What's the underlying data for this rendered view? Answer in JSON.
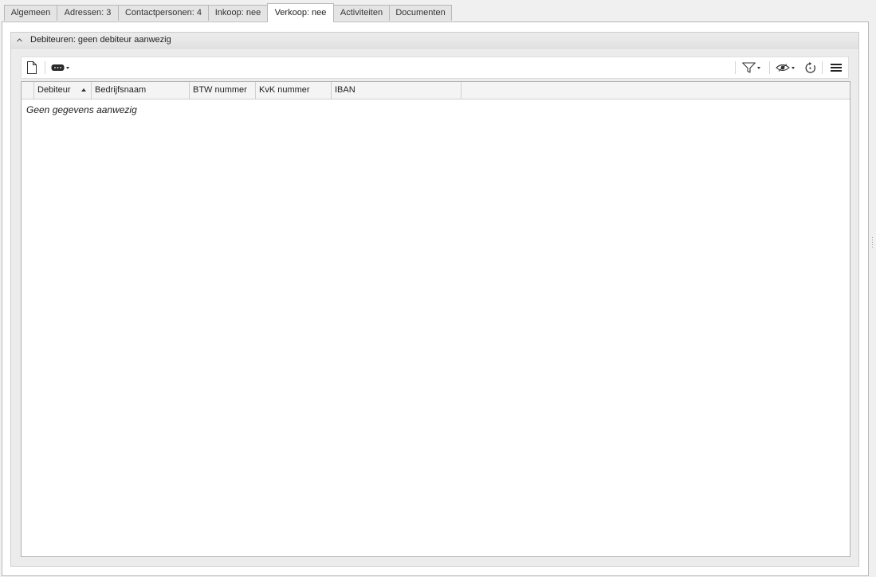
{
  "tabs": [
    {
      "label": "Algemeen",
      "active": false
    },
    {
      "label": "Adressen: 3",
      "active": false
    },
    {
      "label": "Contactpersonen: 4",
      "active": false
    },
    {
      "label": "Inkoop: nee",
      "active": false
    },
    {
      "label": "Verkoop: nee",
      "active": true
    },
    {
      "label": "Activiteiten",
      "active": false
    },
    {
      "label": "Documenten",
      "active": false
    }
  ],
  "group": {
    "title": "Debiteuren: geen debiteur aanwezig"
  },
  "toolbar": {
    "left_icons": [
      "new-document-icon",
      "view-mode-icon"
    ],
    "right_icons": [
      "filter-icon",
      "visibility-icon",
      "refresh-icon",
      "menu-icon"
    ]
  },
  "grid": {
    "columns": [
      "Debiteur",
      "Bedrijfsnaam",
      "BTW nummer",
      "KvK nummer",
      "IBAN"
    ],
    "sorted_column": "Debiteur",
    "sort_direction": "ascending",
    "rows": [],
    "empty_message": "Geen gegevens aanwezig"
  }
}
